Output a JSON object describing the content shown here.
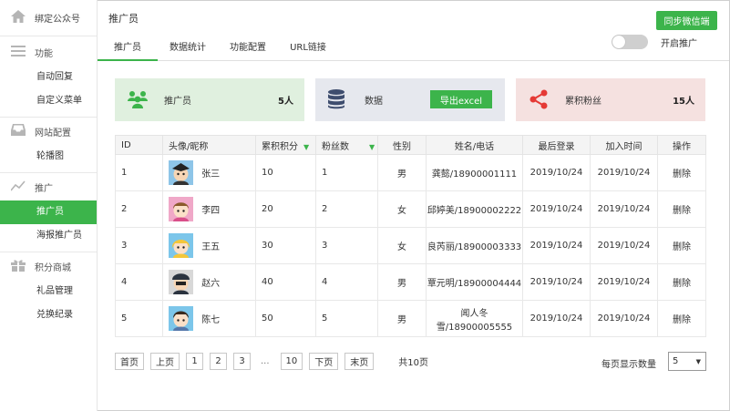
{
  "sidebar": {
    "header": "绑定公众号",
    "groups": [
      {
        "label": "功能",
        "icon": "menu-icon",
        "items": [
          "自动回复",
          "自定义菜单"
        ]
      },
      {
        "label": "网站配置",
        "icon": "inbox-icon",
        "items": [
          "轮播图"
        ]
      },
      {
        "label": "推广",
        "icon": "chart-icon",
        "items": [
          "推广员",
          "海报推广员"
        ]
      },
      {
        "label": "积分商城",
        "icon": "gift-icon",
        "items": [
          "礼品管理",
          "兑换纪录"
        ]
      }
    ],
    "active_item": "推广员"
  },
  "header": {
    "title": "推广员",
    "sync_button": "同步微信端"
  },
  "tabs": [
    "推广员",
    "数据统计",
    "功能配置",
    "URL链接"
  ],
  "toggle": {
    "label": "开启推广",
    "on": false
  },
  "cards": {
    "promoters": {
      "label": "推广员",
      "value": "5人",
      "color": "#e0f0df"
    },
    "data": {
      "label": "数据",
      "button": "导出excel",
      "color": "#e6e8ee"
    },
    "fans": {
      "label": "累积粉丝",
      "value": "15人",
      "color": "#f5e1e0"
    }
  },
  "table": {
    "columns": [
      "ID",
      "头像/昵称",
      "累积积分",
      "粉丝数",
      "性别",
      "姓名/电话",
      "最后登录",
      "加入时间",
      "操作"
    ],
    "rows": [
      {
        "id": "1",
        "nick": "张三",
        "points": "10",
        "fans": "1",
        "gender": "男",
        "contact": "龚懿/18900001111",
        "last_login": "2019/10/24",
        "joined": "2019/10/24",
        "action": "删除"
      },
      {
        "id": "2",
        "nick": "李四",
        "points": "20",
        "fans": "2",
        "gender": "女",
        "contact": "邱婷美/18900002222",
        "last_login": "2019/10/24",
        "joined": "2019/10/24",
        "action": "删除"
      },
      {
        "id": "3",
        "nick": "王五",
        "points": "30",
        "fans": "3",
        "gender": "女",
        "contact": "良芮丽/18900003333",
        "last_login": "2019/10/24",
        "joined": "2019/10/24",
        "action": "删除"
      },
      {
        "id": "4",
        "nick": "赵六",
        "points": "40",
        "fans": "4",
        "gender": "男",
        "contact": "覃元明/18900004444",
        "last_login": "2019/10/24",
        "joined": "2019/10/24",
        "action": "删除"
      },
      {
        "id": "5",
        "nick": "陈七",
        "points": "50",
        "fans": "5",
        "gender": "男",
        "contact": "闻人冬雪/18900005555",
        "last_login": "2019/10/24",
        "joined": "2019/10/24",
        "action": "删除"
      }
    ]
  },
  "pagination": {
    "first": "首页",
    "prev": "上页",
    "pages": [
      "1",
      "2",
      "3"
    ],
    "ellipsis": "...",
    "last_page": "10",
    "next": "下页",
    "end": "末页",
    "total": "共10页",
    "per_page_label": "每页显示数量",
    "per_page_value": "5"
  },
  "colors": {
    "accent": "#3cb44b",
    "fans_red": "#e53935"
  }
}
